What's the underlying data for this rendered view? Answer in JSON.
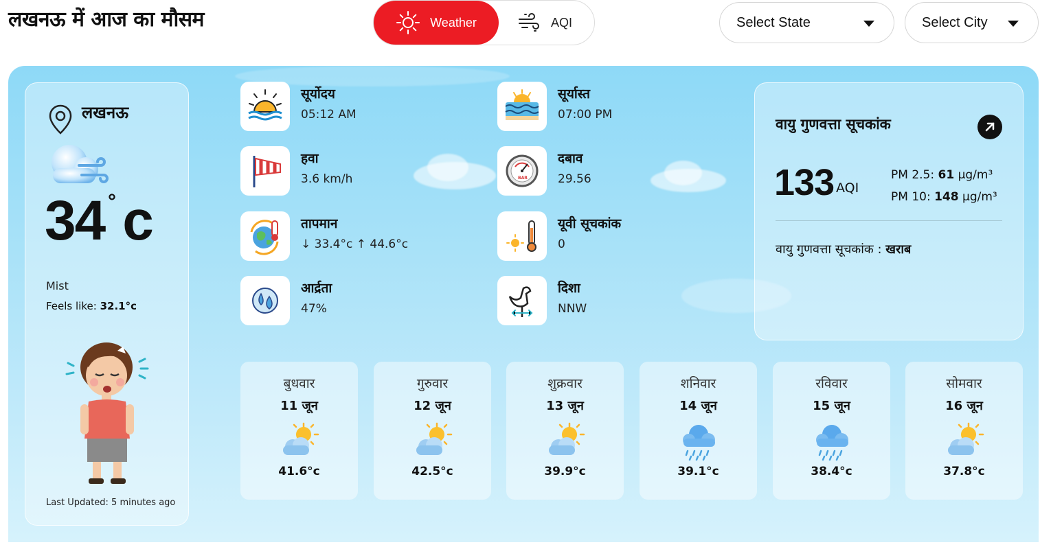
{
  "header": {
    "title": "लखनऊ में आज का मौसम",
    "tabs": [
      {
        "label": "Weather",
        "icon": "sun-icon",
        "active": true
      },
      {
        "label": "AQI",
        "icon": "wind-icon",
        "active": false
      }
    ],
    "select_state": "Select State",
    "select_city": "Select City"
  },
  "current": {
    "city": "लखनऊ",
    "temp": "34",
    "degree": "°",
    "unit": "c",
    "condition": "Mist",
    "feels_label": "Feels like:",
    "feels_value": "32.1°c",
    "last_updated": "Last Updated: 5 minutes ago"
  },
  "stats": [
    {
      "label": "सूर्योदय",
      "value": "05:12 AM",
      "icon": "sunrise-icon"
    },
    {
      "label": "सूर्यास्त",
      "value": "07:00 PM",
      "icon": "sunset-icon"
    },
    {
      "label": "हवा",
      "value": "3.6 km/h",
      "icon": "windsock-icon"
    },
    {
      "label": "दबाव",
      "value": "29.56",
      "icon": "barometer-icon"
    },
    {
      "label": "तापमान",
      "value": "↓ 33.4°c ↑ 44.6°c",
      "icon": "temperature-globe-icon"
    },
    {
      "label": "यूवी सूचकांक",
      "value": "0",
      "icon": "uv-index-icon"
    },
    {
      "label": "आर्द्रता",
      "value": "47%",
      "icon": "humidity-icon"
    },
    {
      "label": "दिशा",
      "value": "NNW",
      "icon": "weathervane-icon"
    }
  ],
  "aqi": {
    "title": "वायु गुणवत्ता सूचकांक",
    "value": "133",
    "unit": "AQI",
    "pm25_label": "PM 2.5:",
    "pm25_value": "61",
    "pm25_unit": "µg/m³",
    "pm10_label": "PM 10:",
    "pm10_value": "148",
    "pm10_unit": "µg/m³",
    "status_label": "वायु गुणवत्ता सूचकांक :",
    "status_value": "खराब"
  },
  "forecast": [
    {
      "day": "बुधवार",
      "date": "11 जून",
      "temp": "41.6°c",
      "icon": "sun-behind-cloud-icon"
    },
    {
      "day": "गुरुवार",
      "date": "12 जून",
      "temp": "42.5°c",
      "icon": "sun-behind-cloud-icon"
    },
    {
      "day": "शुक्रवार",
      "date": "13 जून",
      "temp": "39.9°c",
      "icon": "sun-behind-cloud-icon"
    },
    {
      "day": "शनिवार",
      "date": "14 जून",
      "temp": "39.1°c",
      "icon": "rain-cloud-icon"
    },
    {
      "day": "रविवार",
      "date": "15 जून",
      "temp": "38.4°c",
      "icon": "rain-cloud-icon"
    },
    {
      "day": "सोमवार",
      "date": "16 जून",
      "temp": "37.8°c",
      "icon": "sun-behind-cloud-icon"
    }
  ],
  "colors": {
    "accent": "#ec1c24",
    "sky_top": "#8ed9f7",
    "sky_bottom": "#d6f2fc"
  }
}
